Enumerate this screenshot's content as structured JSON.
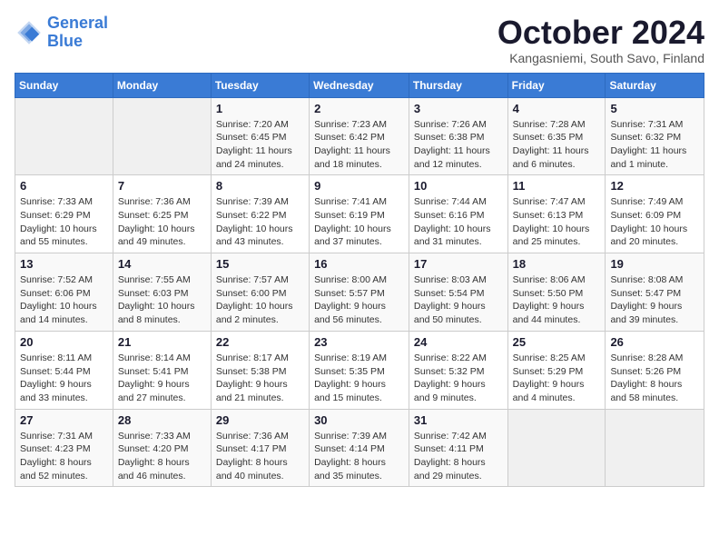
{
  "logo": {
    "line1": "General",
    "line2": "Blue"
  },
  "title": "October 2024",
  "location": "Kangasniemi, South Savo, Finland",
  "days_header": [
    "Sunday",
    "Monday",
    "Tuesday",
    "Wednesday",
    "Thursday",
    "Friday",
    "Saturday"
  ],
  "weeks": [
    [
      {
        "day": "",
        "info": ""
      },
      {
        "day": "",
        "info": ""
      },
      {
        "day": "1",
        "info": "Sunrise: 7:20 AM\nSunset: 6:45 PM\nDaylight: 11 hours and 24 minutes."
      },
      {
        "day": "2",
        "info": "Sunrise: 7:23 AM\nSunset: 6:42 PM\nDaylight: 11 hours and 18 minutes."
      },
      {
        "day": "3",
        "info": "Sunrise: 7:26 AM\nSunset: 6:38 PM\nDaylight: 11 hours and 12 minutes."
      },
      {
        "day": "4",
        "info": "Sunrise: 7:28 AM\nSunset: 6:35 PM\nDaylight: 11 hours and 6 minutes."
      },
      {
        "day": "5",
        "info": "Sunrise: 7:31 AM\nSunset: 6:32 PM\nDaylight: 11 hours and 1 minute."
      }
    ],
    [
      {
        "day": "6",
        "info": "Sunrise: 7:33 AM\nSunset: 6:29 PM\nDaylight: 10 hours and 55 minutes."
      },
      {
        "day": "7",
        "info": "Sunrise: 7:36 AM\nSunset: 6:25 PM\nDaylight: 10 hours and 49 minutes."
      },
      {
        "day": "8",
        "info": "Sunrise: 7:39 AM\nSunset: 6:22 PM\nDaylight: 10 hours and 43 minutes."
      },
      {
        "day": "9",
        "info": "Sunrise: 7:41 AM\nSunset: 6:19 PM\nDaylight: 10 hours and 37 minutes."
      },
      {
        "day": "10",
        "info": "Sunrise: 7:44 AM\nSunset: 6:16 PM\nDaylight: 10 hours and 31 minutes."
      },
      {
        "day": "11",
        "info": "Sunrise: 7:47 AM\nSunset: 6:13 PM\nDaylight: 10 hours and 25 minutes."
      },
      {
        "day": "12",
        "info": "Sunrise: 7:49 AM\nSunset: 6:09 PM\nDaylight: 10 hours and 20 minutes."
      }
    ],
    [
      {
        "day": "13",
        "info": "Sunrise: 7:52 AM\nSunset: 6:06 PM\nDaylight: 10 hours and 14 minutes."
      },
      {
        "day": "14",
        "info": "Sunrise: 7:55 AM\nSunset: 6:03 PM\nDaylight: 10 hours and 8 minutes."
      },
      {
        "day": "15",
        "info": "Sunrise: 7:57 AM\nSunset: 6:00 PM\nDaylight: 10 hours and 2 minutes."
      },
      {
        "day": "16",
        "info": "Sunrise: 8:00 AM\nSunset: 5:57 PM\nDaylight: 9 hours and 56 minutes."
      },
      {
        "day": "17",
        "info": "Sunrise: 8:03 AM\nSunset: 5:54 PM\nDaylight: 9 hours and 50 minutes."
      },
      {
        "day": "18",
        "info": "Sunrise: 8:06 AM\nSunset: 5:50 PM\nDaylight: 9 hours and 44 minutes."
      },
      {
        "day": "19",
        "info": "Sunrise: 8:08 AM\nSunset: 5:47 PM\nDaylight: 9 hours and 39 minutes."
      }
    ],
    [
      {
        "day": "20",
        "info": "Sunrise: 8:11 AM\nSunset: 5:44 PM\nDaylight: 9 hours and 33 minutes."
      },
      {
        "day": "21",
        "info": "Sunrise: 8:14 AM\nSunset: 5:41 PM\nDaylight: 9 hours and 27 minutes."
      },
      {
        "day": "22",
        "info": "Sunrise: 8:17 AM\nSunset: 5:38 PM\nDaylight: 9 hours and 21 minutes."
      },
      {
        "day": "23",
        "info": "Sunrise: 8:19 AM\nSunset: 5:35 PM\nDaylight: 9 hours and 15 minutes."
      },
      {
        "day": "24",
        "info": "Sunrise: 8:22 AM\nSunset: 5:32 PM\nDaylight: 9 hours and 9 minutes."
      },
      {
        "day": "25",
        "info": "Sunrise: 8:25 AM\nSunset: 5:29 PM\nDaylight: 9 hours and 4 minutes."
      },
      {
        "day": "26",
        "info": "Sunrise: 8:28 AM\nSunset: 5:26 PM\nDaylight: 8 hours and 58 minutes."
      }
    ],
    [
      {
        "day": "27",
        "info": "Sunrise: 7:31 AM\nSunset: 4:23 PM\nDaylight: 8 hours and 52 minutes."
      },
      {
        "day": "28",
        "info": "Sunrise: 7:33 AM\nSunset: 4:20 PM\nDaylight: 8 hours and 46 minutes."
      },
      {
        "day": "29",
        "info": "Sunrise: 7:36 AM\nSunset: 4:17 PM\nDaylight: 8 hours and 40 minutes."
      },
      {
        "day": "30",
        "info": "Sunrise: 7:39 AM\nSunset: 4:14 PM\nDaylight: 8 hours and 35 minutes."
      },
      {
        "day": "31",
        "info": "Sunrise: 7:42 AM\nSunset: 4:11 PM\nDaylight: 8 hours and 29 minutes."
      },
      {
        "day": "",
        "info": ""
      },
      {
        "day": "",
        "info": ""
      }
    ]
  ]
}
